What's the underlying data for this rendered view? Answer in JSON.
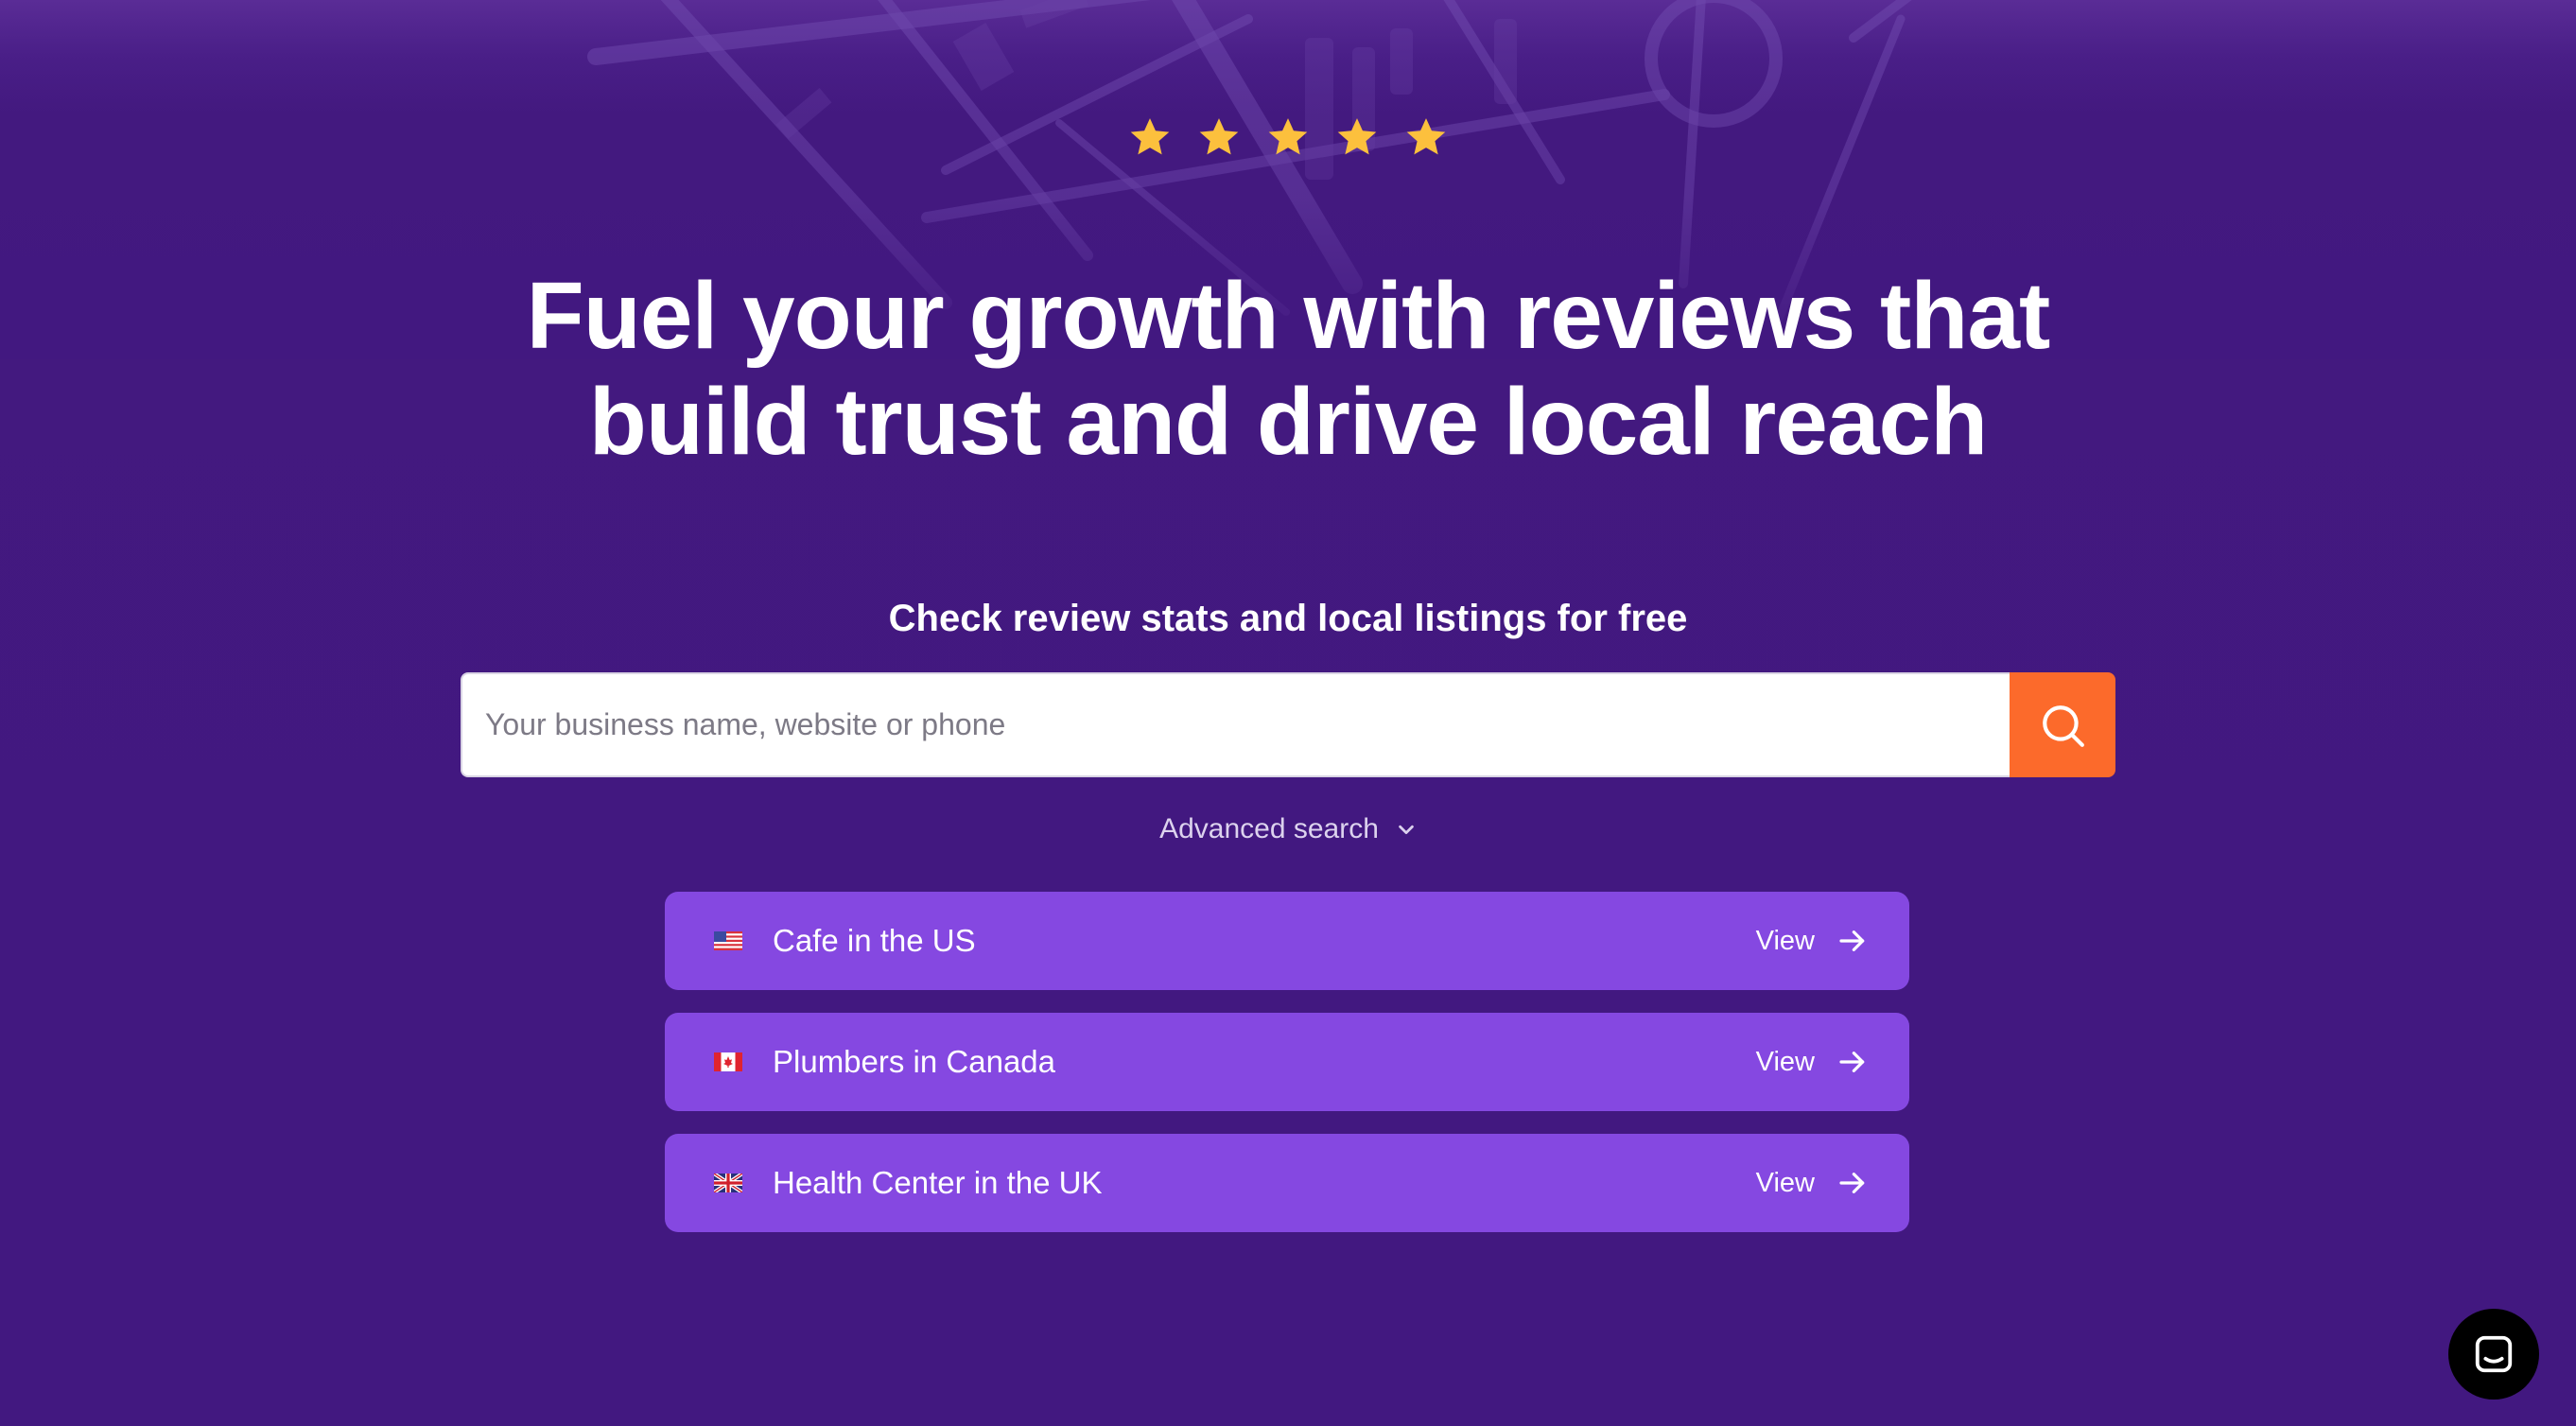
{
  "hero": {
    "rating_stars": 5,
    "headline_line1": "Fuel your growth with reviews that",
    "headline_line2": "build trust and drive local reach",
    "subheading": "Check review stats and local listings for free"
  },
  "search": {
    "placeholder": "Your business name, website or phone",
    "value": "",
    "button_icon": "search-icon",
    "button_color": "#fc6a2b"
  },
  "advanced_search": {
    "label": "Advanced search",
    "icon": "chevron-down-icon"
  },
  "examples": [
    {
      "flag": "us-flag-icon",
      "label": "Cafe in the US",
      "action": "View"
    },
    {
      "flag": "ca-flag-icon",
      "label": "Plumbers in Canada",
      "action": "View"
    },
    {
      "flag": "uk-flag-icon",
      "label": "Health Center in the UK",
      "action": "View"
    }
  ],
  "chat": {
    "icon": "chat-icon"
  },
  "colors": {
    "background": "#42197f",
    "star": "#fcc03d",
    "example_card": "#8548e1",
    "search_button": "#fc6a2b"
  }
}
